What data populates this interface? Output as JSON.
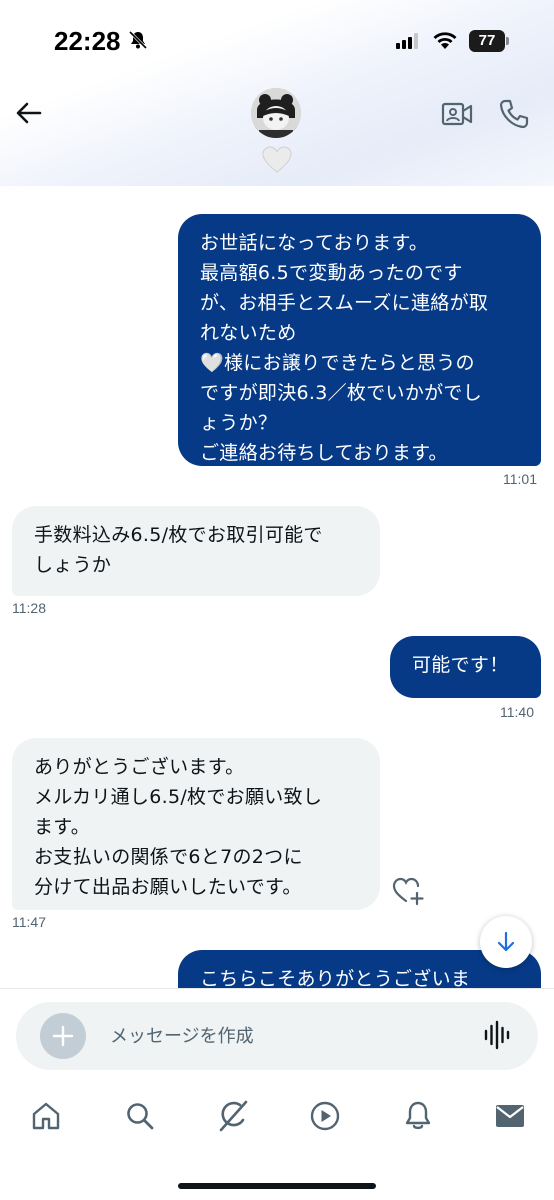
{
  "status_bar": {
    "time": "22:28",
    "battery": "77"
  },
  "header": {
    "profile_emoji": "🤍"
  },
  "messages": [
    {
      "direction": "out",
      "text": "お世話になっております。\n最高額6.5で変動あったのです\nが、お相手とスムーズに連絡が取\nれないため\n🤍様にお譲りできたらと思うの\nですが即決6.3／枚でいかがでし\nょうか？\nご連絡お待ちしております。",
      "time": "11:01"
    },
    {
      "direction": "in",
      "text": "手数料込み6.5/枚でお取引可能で\nしょうか",
      "time": "11:28"
    },
    {
      "direction": "out",
      "text": "可能です！",
      "time": "11:40"
    },
    {
      "direction": "in",
      "text": "ありがとうございます。\nメルカリ通し6.5/枚でお願い致し\nます。\nお支払いの関係で6と7の2つに\n分けて出品お願いしたいです。",
      "time": "11:47"
    },
    {
      "direction": "out",
      "text": "こちらこそありがとうございま",
      "time": ""
    }
  ],
  "composer": {
    "placeholder": "メッセージを作成"
  },
  "colors": {
    "outgoing_bubble": "#063a87",
    "incoming_bubble": "#eff3f4",
    "text_secondary": "#536471"
  },
  "nav": {
    "items": [
      "home-icon",
      "search-icon",
      "grok-icon",
      "video-icon",
      "notifications-icon",
      "messages-icon"
    ]
  }
}
